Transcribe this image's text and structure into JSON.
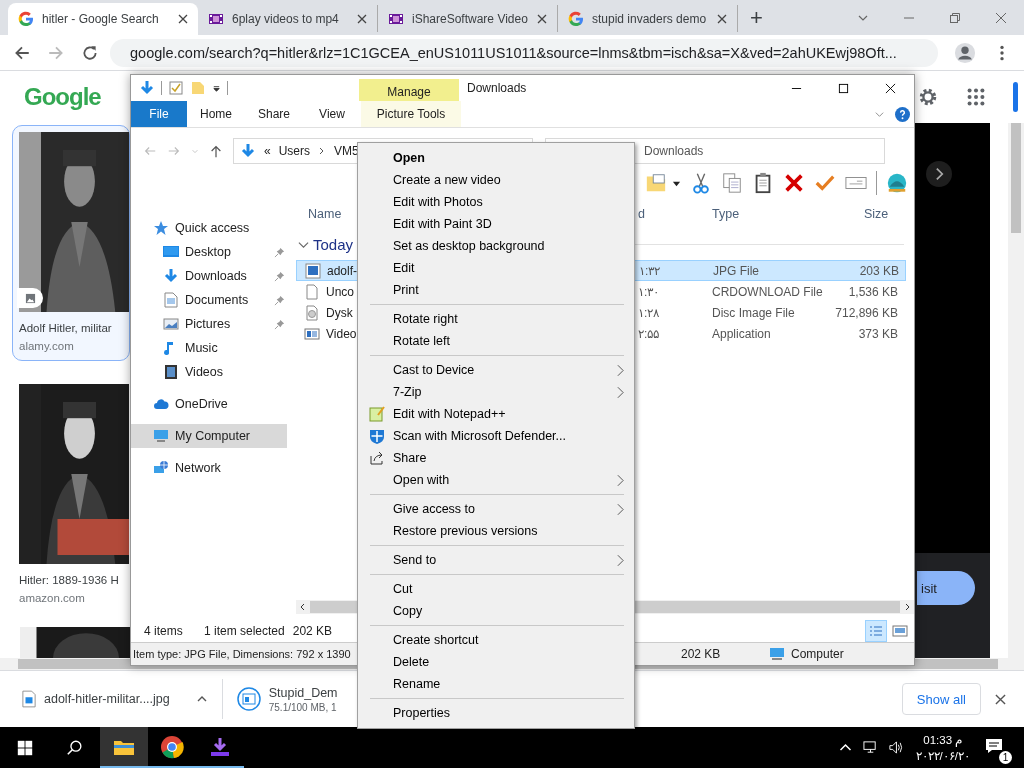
{
  "browser": {
    "tabs": [
      {
        "title": "hitler - Google Search",
        "selected": true
      },
      {
        "title": "6play videos to mp4",
        "selected": false
      },
      {
        "title": "iShareSoftware Video",
        "selected": false
      },
      {
        "title": "stupid invaders demo",
        "selected": false
      }
    ],
    "new_tab": "+",
    "url": "google.com/search?q=hitler&rlz=1C1GCEA_enUS1011US1011&source=lnms&tbm=isch&sa=X&ved=2ahUKEwj98Oft..."
  },
  "page": {
    "logo": "Google",
    "results": [
      {
        "caption": "Adolf Hitler, militar",
        "source": "alamy.com",
        "selected": true
      },
      {
        "caption": "Hitler: 1889-1936 H",
        "source": "amazon.com",
        "selected": false
      }
    ],
    "visit_button": "isit"
  },
  "explorer": {
    "title": "Downloads",
    "contextual_tab": "Manage",
    "ribbon_tabs": [
      {
        "label": "File",
        "kind": "file",
        "selected": false
      },
      {
        "label": "Home",
        "kind": "tab",
        "selected": false
      },
      {
        "label": "Share",
        "kind": "tab",
        "selected": false
      },
      {
        "label": "View",
        "kind": "tab",
        "selected": false
      },
      {
        "label": "Picture Tools",
        "kind": "context",
        "selected": false
      }
    ],
    "breadcrumb_prefix": "«",
    "breadcrumb": [
      "Users",
      "VM5"
    ],
    "search_box": "Downloads",
    "nav": [
      {
        "label": "Quick access",
        "selected": false,
        "children": [
          {
            "label": "Desktop",
            "pinned": true,
            "selected": false
          },
          {
            "label": "Downloads",
            "pinned": true,
            "selected": false
          },
          {
            "label": "Documents",
            "pinned": true,
            "selected": false
          },
          {
            "label": "Pictures",
            "pinned": true,
            "selected": false
          },
          {
            "label": "Music",
            "pinned": false,
            "selected": false
          },
          {
            "label": "Videos",
            "pinned": false,
            "selected": false
          }
        ]
      },
      {
        "label": "OneDrive",
        "selected": false
      },
      {
        "label": "My Computer",
        "selected": true
      },
      {
        "label": "Network",
        "selected": false
      }
    ],
    "columns": [
      "Name",
      "d",
      "Type",
      "Size"
    ],
    "group": "Today",
    "files": [
      {
        "name": "adolf-",
        "modified": "۱:۳۲",
        "type": "JPG File",
        "size": "203 KB",
        "selected": true
      },
      {
        "name": "Unco",
        "modified": "۱:۳۰",
        "type": "CRDOWNLOAD File",
        "size": "1,536 KB",
        "selected": false
      },
      {
        "name": "Dysk",
        "modified": "۱:۲۸",
        "type": "Disc Image File",
        "size": "712,896 KB",
        "selected": false
      },
      {
        "name": "Video",
        "modified": "۲:۵۵",
        "type": "Application",
        "size": "373 KB",
        "selected": false
      }
    ],
    "status": {
      "count": "4 items",
      "selection": "1 item selected",
      "size": "202 KB"
    },
    "details_bar": {
      "info": "Item type: JPG File, Dimensions: 792 x 1390",
      "size": "202 KB",
      "location": "Computer"
    }
  },
  "context_menu": [
    {
      "kind": "item",
      "label": "Open",
      "default": true
    },
    {
      "kind": "item",
      "label": "Create a new video"
    },
    {
      "kind": "item",
      "label": "Edit with Photos"
    },
    {
      "kind": "item",
      "label": "Edit with Paint 3D"
    },
    {
      "kind": "item",
      "label": "Set as desktop background"
    },
    {
      "kind": "item",
      "label": "Edit"
    },
    {
      "kind": "item",
      "label": "Print"
    },
    {
      "kind": "separator"
    },
    {
      "kind": "item",
      "label": "Rotate right"
    },
    {
      "kind": "item",
      "label": "Rotate left"
    },
    {
      "kind": "separator"
    },
    {
      "kind": "item",
      "label": "Cast to Device",
      "submenu": true
    },
    {
      "kind": "item",
      "label": "7-Zip",
      "submenu": true
    },
    {
      "kind": "item",
      "label": "Edit with Notepad++"
    },
    {
      "kind": "item",
      "label": "Scan with Microsoft Defender..."
    },
    {
      "kind": "item",
      "label": "Share"
    },
    {
      "kind": "item",
      "label": "Open with",
      "submenu": true
    },
    {
      "kind": "separator"
    },
    {
      "kind": "item",
      "label": "Give access to",
      "submenu": true
    },
    {
      "kind": "item",
      "label": "Restore previous versions"
    },
    {
      "kind": "separator"
    },
    {
      "kind": "item",
      "label": "Send to",
      "submenu": true
    },
    {
      "kind": "separator"
    },
    {
      "kind": "item",
      "label": "Cut"
    },
    {
      "kind": "item",
      "label": "Copy"
    },
    {
      "kind": "separator"
    },
    {
      "kind": "item",
      "label": "Create shortcut"
    },
    {
      "kind": "item",
      "label": "Delete"
    },
    {
      "kind": "item",
      "label": "Rename"
    },
    {
      "kind": "separator"
    },
    {
      "kind": "item",
      "label": "Properties"
    }
  ],
  "downloads": {
    "items": [
      {
        "name": "adolf-hitler-militar....jpg"
      },
      {
        "name": "Stupid_Dem",
        "detail": "75.1/100 MB, 1"
      }
    ],
    "show_all": "Show all"
  },
  "taskbar": {
    "apps": [
      {
        "active": true
      },
      {
        "active": true
      },
      {
        "active": true
      }
    ],
    "time": "01:33 م",
    "date": "۲۰۲۲/۰۶/۲۰",
    "notifications": "1"
  }
}
